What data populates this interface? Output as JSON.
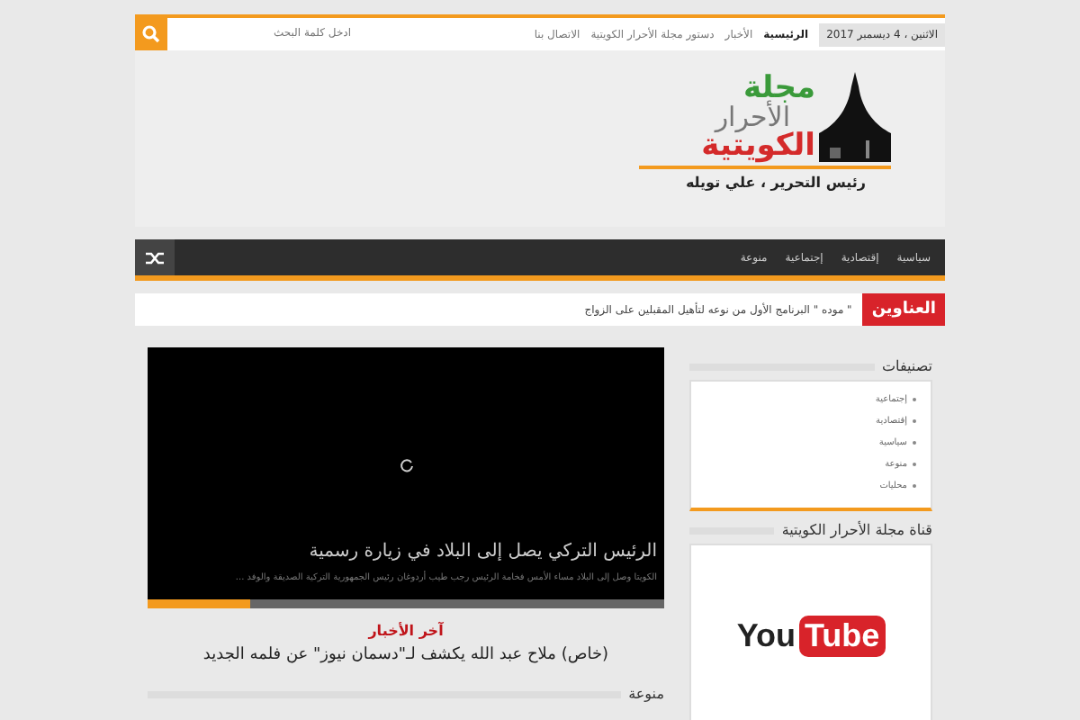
{
  "top_bar": {
    "date": "الاثنين ، 4 ديسمبر 2017",
    "menu": [
      {
        "label": "الرئيسية",
        "selected": true
      },
      {
        "label": "الأخبار",
        "selected": false
      },
      {
        "label": "دستور مجلة الأحرار الكويتية",
        "selected": false
      },
      {
        "label": "الاتصال بنا",
        "selected": false
      }
    ],
    "search": {
      "placeholder": "ادخل كلمة البحث"
    }
  },
  "logo": {
    "line_1": "مجلة",
    "line_2": "الأحرار",
    "line_3": "الكويتية",
    "editor": "رئيس التحرير ، علي تويله"
  },
  "nav": [
    "سياسية",
    "إقتصادية",
    "إجتماعية",
    "منوعة"
  ],
  "ticker": {
    "label": "العناوين",
    "text": "\" موده \" البرنامج الأول من نوعه لتأهيل المقبلين على الزواج"
  },
  "slider": {
    "title": "الرئيس التركي يصل إلى البلاد في زيارة رسمية",
    "excerpt": "الكويتا وصل إلى البلاد مساء الأمس فخامة الرئيس رجب طيب أردوغان رئيس الجمهورية التركية الصديقة والوفد ...",
    "level": 0.2
  },
  "latest": {
    "heading": "آخر الأخبار",
    "headline": "(خاص) ملاح عبد الله يكشف لـ\"دسمان نيوز\" عن فلمه الجديد"
  },
  "section_heading": "منوعة",
  "sidebar": {
    "categories_title": "تصنيفات",
    "categories": [
      "إجتماعية",
      "إقتصادية",
      "سياسية",
      "منوعة",
      "محليات"
    ],
    "channel_title": "قناة مجلة الأحرار الكويتية",
    "youtube": {
      "you": "You",
      "tube": "Tube"
    }
  }
}
